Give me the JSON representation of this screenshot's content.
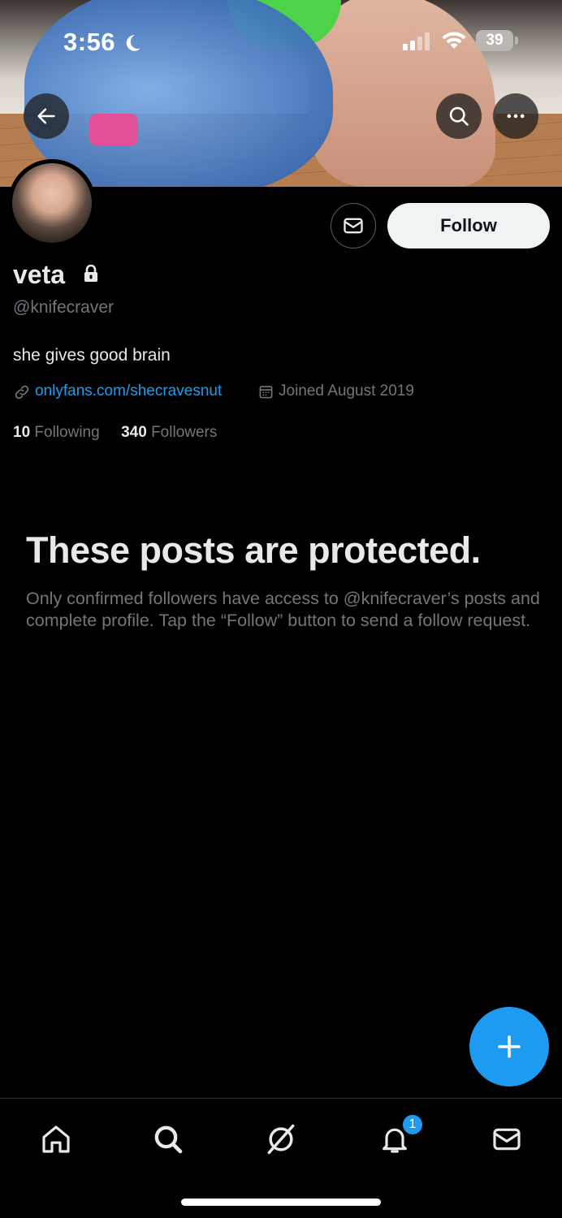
{
  "status_bar": {
    "time": "3:56",
    "battery": "39"
  },
  "profile": {
    "name": "veta",
    "handle": "@knifecraver",
    "bio": "she gives good brain",
    "link": "onlyfans.com/shecravesnut",
    "joined": "Joined August 2019",
    "following_count": "10",
    "following_label": "Following",
    "followers_count": "340",
    "followers_label": "Followers",
    "follow_button": "Follow"
  },
  "protected": {
    "title": "These posts are protected.",
    "description": "Only confirmed followers have access to @knifecraver’s posts and complete profile. Tap the “Follow” button to send a follow request."
  },
  "tabbar": {
    "notifications_badge": "1"
  },
  "colors": {
    "accent": "#1d9bf0",
    "background": "#000000",
    "primary_text": "#e7e9ea",
    "secondary_text": "#71767b"
  }
}
